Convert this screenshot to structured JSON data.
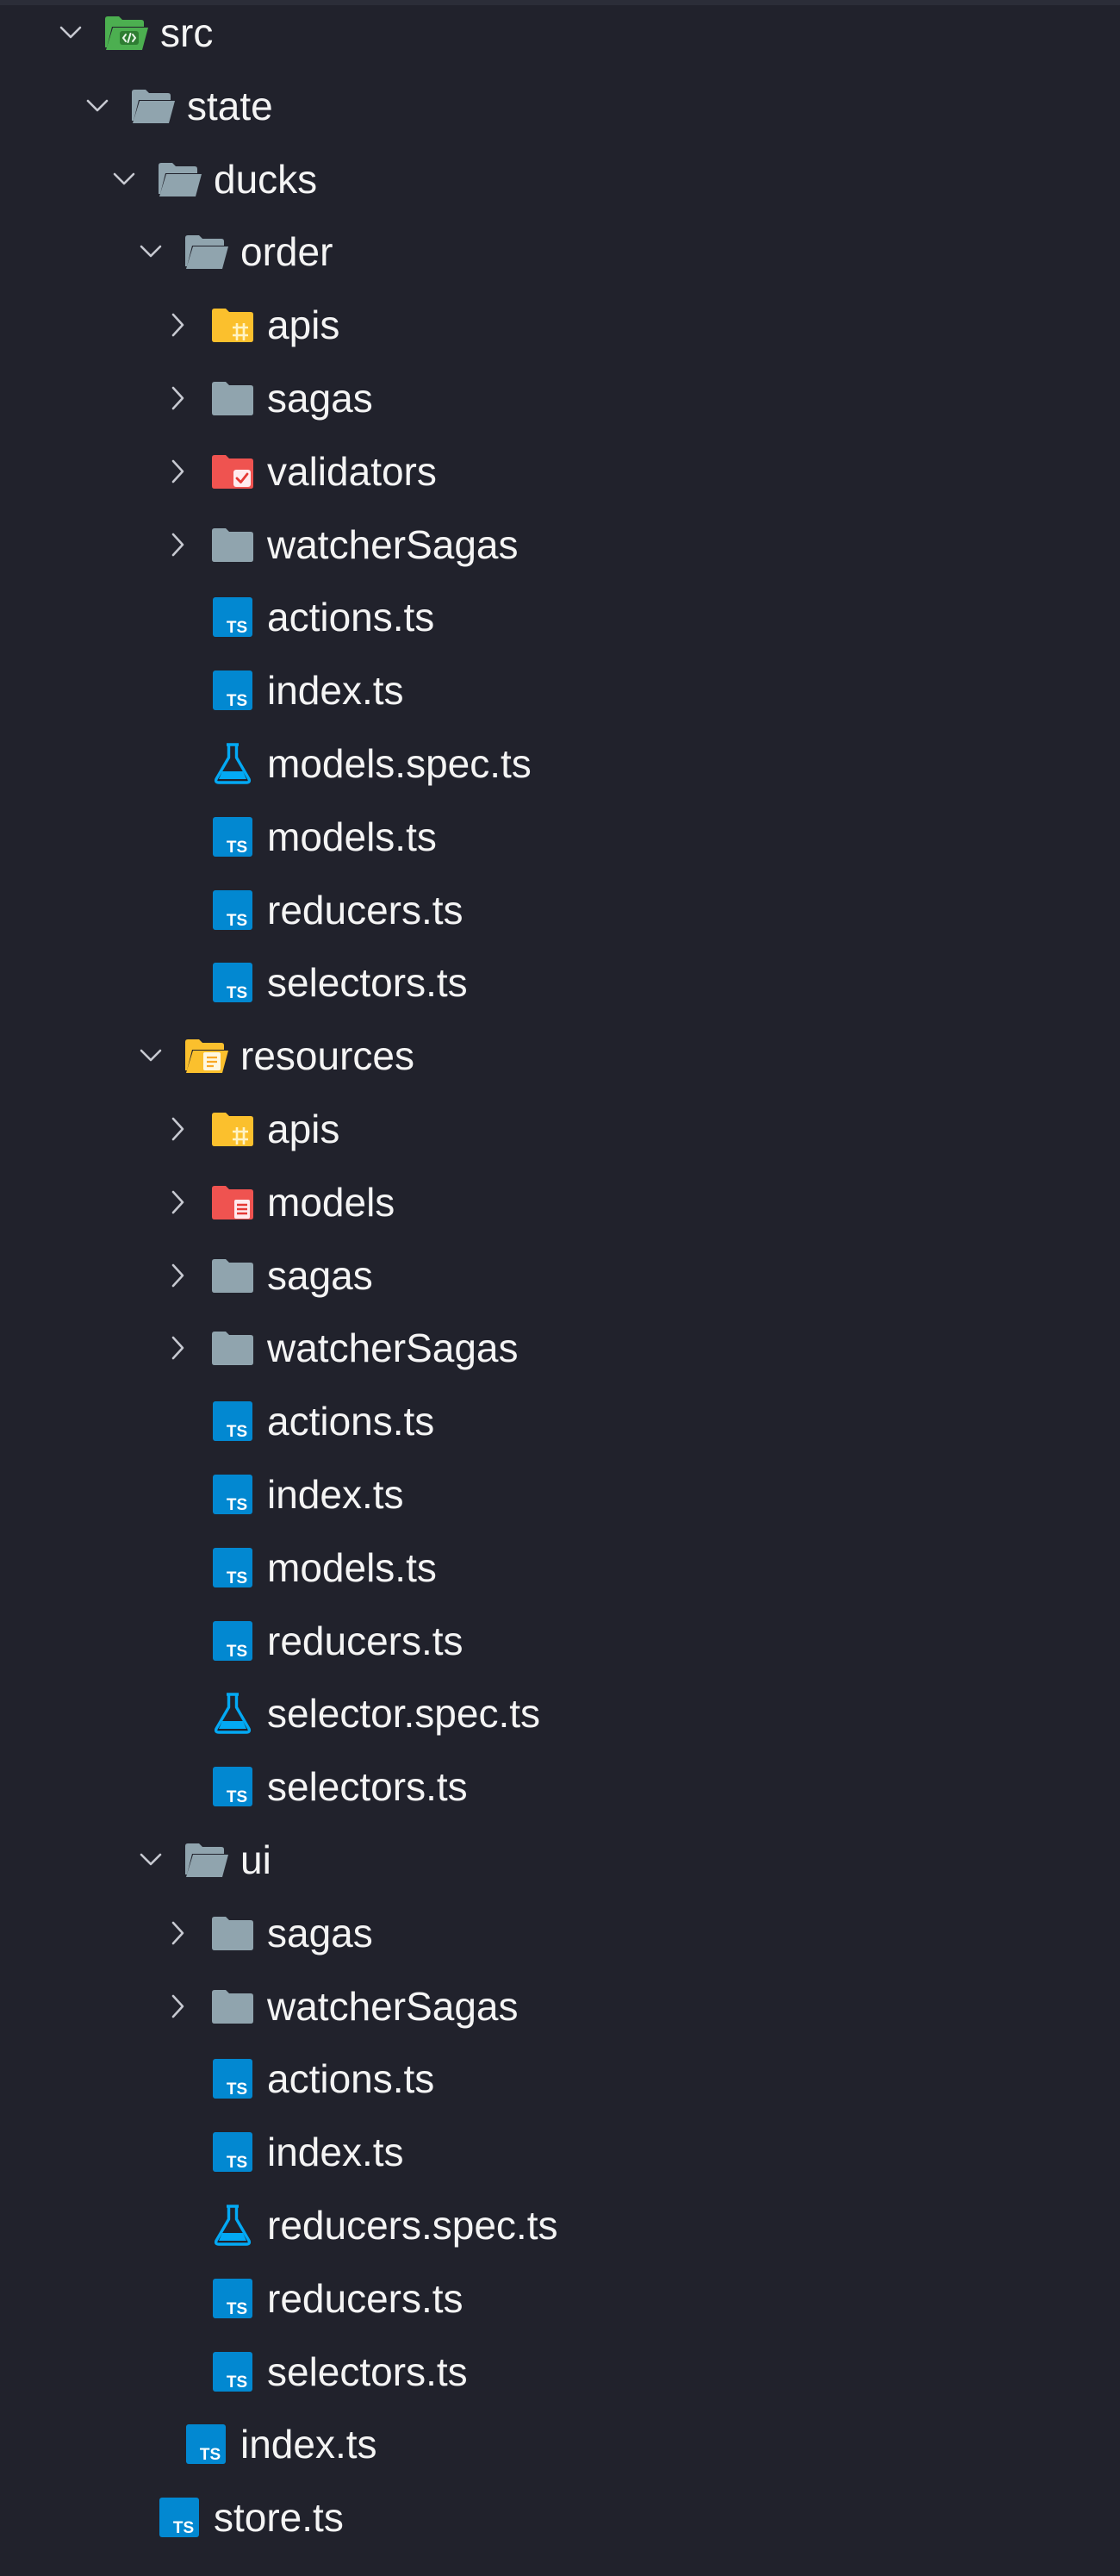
{
  "tree": [
    {
      "label": "src",
      "depth": 0,
      "kind": "folder",
      "expanded": true,
      "icon": "src-folder-open-icon",
      "color": "#4caf50"
    },
    {
      "label": "state",
      "depth": 1,
      "kind": "folder",
      "expanded": true,
      "icon": "folder-open-icon",
      "color": "#90a4ae"
    },
    {
      "label": "ducks",
      "depth": 2,
      "kind": "folder",
      "expanded": true,
      "icon": "folder-open-icon",
      "color": "#90a4ae"
    },
    {
      "label": "order",
      "depth": 3,
      "kind": "folder",
      "expanded": true,
      "icon": "folder-open-icon",
      "color": "#90a4ae"
    },
    {
      "label": "apis",
      "depth": 4,
      "kind": "folder",
      "expanded": false,
      "icon": "api-folder-icon",
      "color": "#fbc02d"
    },
    {
      "label": "sagas",
      "depth": 4,
      "kind": "folder",
      "expanded": false,
      "icon": "folder-icon",
      "color": "#90a4ae"
    },
    {
      "label": "validators",
      "depth": 4,
      "kind": "folder",
      "expanded": false,
      "icon": "validators-folder-icon",
      "color": "#ef5350"
    },
    {
      "label": "watcherSagas",
      "depth": 4,
      "kind": "folder",
      "expanded": false,
      "icon": "folder-icon",
      "color": "#90a4ae"
    },
    {
      "label": "actions.ts",
      "depth": 4,
      "kind": "file",
      "icon": "typescript-file-icon",
      "color": "#0288d1"
    },
    {
      "label": "index.ts",
      "depth": 4,
      "kind": "file",
      "icon": "typescript-file-icon",
      "color": "#0288d1"
    },
    {
      "label": "models.spec.ts",
      "depth": 4,
      "kind": "file",
      "icon": "test-flask-icon",
      "color": "#03a9f4"
    },
    {
      "label": "models.ts",
      "depth": 4,
      "kind": "file",
      "icon": "typescript-file-icon",
      "color": "#0288d1"
    },
    {
      "label": "reducers.ts",
      "depth": 4,
      "kind": "file",
      "icon": "typescript-file-icon",
      "color": "#0288d1"
    },
    {
      "label": "selectors.ts",
      "depth": 4,
      "kind": "file",
      "icon": "typescript-file-icon",
      "color": "#0288d1"
    },
    {
      "label": "resources",
      "depth": 3,
      "kind": "folder",
      "expanded": true,
      "icon": "resources-folder-open-icon",
      "color": "#fbc02d"
    },
    {
      "label": "apis",
      "depth": 4,
      "kind": "folder",
      "expanded": false,
      "icon": "api-folder-icon",
      "color": "#fbc02d"
    },
    {
      "label": "models",
      "depth": 4,
      "kind": "folder",
      "expanded": false,
      "icon": "models-folder-icon",
      "color": "#ef5350"
    },
    {
      "label": "sagas",
      "depth": 4,
      "kind": "folder",
      "expanded": false,
      "icon": "folder-icon",
      "color": "#90a4ae"
    },
    {
      "label": "watcherSagas",
      "depth": 4,
      "kind": "folder",
      "expanded": false,
      "icon": "folder-icon",
      "color": "#90a4ae"
    },
    {
      "label": "actions.ts",
      "depth": 4,
      "kind": "file",
      "icon": "typescript-file-icon",
      "color": "#0288d1"
    },
    {
      "label": "index.ts",
      "depth": 4,
      "kind": "file",
      "icon": "typescript-file-icon",
      "color": "#0288d1"
    },
    {
      "label": "models.ts",
      "depth": 4,
      "kind": "file",
      "icon": "typescript-file-icon",
      "color": "#0288d1"
    },
    {
      "label": "reducers.ts",
      "depth": 4,
      "kind": "file",
      "icon": "typescript-file-icon",
      "color": "#0288d1"
    },
    {
      "label": "selector.spec.ts",
      "depth": 4,
      "kind": "file",
      "icon": "test-flask-icon",
      "color": "#03a9f4"
    },
    {
      "label": "selectors.ts",
      "depth": 4,
      "kind": "file",
      "icon": "typescript-file-icon",
      "color": "#0288d1"
    },
    {
      "label": "ui",
      "depth": 3,
      "kind": "folder",
      "expanded": true,
      "icon": "folder-open-icon",
      "color": "#90a4ae"
    },
    {
      "label": "sagas",
      "depth": 4,
      "kind": "folder",
      "expanded": false,
      "icon": "folder-icon",
      "color": "#90a4ae"
    },
    {
      "label": "watcherSagas",
      "depth": 4,
      "kind": "folder",
      "expanded": false,
      "icon": "folder-icon",
      "color": "#90a4ae"
    },
    {
      "label": "actions.ts",
      "depth": 4,
      "kind": "file",
      "icon": "typescript-file-icon",
      "color": "#0288d1"
    },
    {
      "label": "index.ts",
      "depth": 4,
      "kind": "file",
      "icon": "typescript-file-icon",
      "color": "#0288d1"
    },
    {
      "label": "reducers.spec.ts",
      "depth": 4,
      "kind": "file",
      "icon": "test-flask-icon",
      "color": "#03a9f4"
    },
    {
      "label": "reducers.ts",
      "depth": 4,
      "kind": "file",
      "icon": "typescript-file-icon",
      "color": "#0288d1"
    },
    {
      "label": "selectors.ts",
      "depth": 4,
      "kind": "file",
      "icon": "typescript-file-icon",
      "color": "#0288d1"
    },
    {
      "label": "index.ts",
      "depth": 3,
      "kind": "file",
      "icon": "typescript-file-icon",
      "color": "#0288d1"
    },
    {
      "label": "store.ts",
      "depth": 2,
      "kind": "file",
      "icon": "typescript-file-icon",
      "color": "#0288d1"
    }
  ]
}
